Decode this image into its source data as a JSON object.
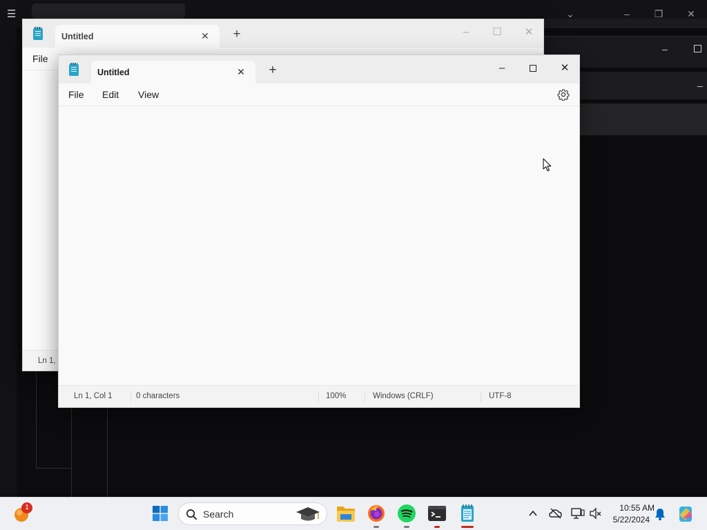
{
  "back_window": {
    "tab_title": "Untitled",
    "menu": {
      "file": "File"
    },
    "status_line": "Ln 1, C"
  },
  "front_window": {
    "tab_title": "Untitled",
    "menu": {
      "file": "File",
      "edit": "Edit",
      "view": "View"
    },
    "editor_text": "",
    "status": {
      "position": "Ln 1, Col 1",
      "characters": "0 characters",
      "zoom": "100%",
      "line_ending": "Windows (CRLF)",
      "encoding": "UTF-8"
    }
  },
  "taskbar": {
    "search_label": "Search",
    "notification_badge": "1",
    "time": "10:55 AM",
    "date": "5/22/2024",
    "apps": [
      "start-icon",
      "search-icon",
      "file-explorer-icon",
      "firefox-icon",
      "spotify-icon",
      "terminal-icon",
      "notepad-icon"
    ]
  },
  "colors": {
    "accent_blue": "#0067c0",
    "taskbar_bg": "#eef0f4",
    "window_bg": "#f9f9f9"
  }
}
